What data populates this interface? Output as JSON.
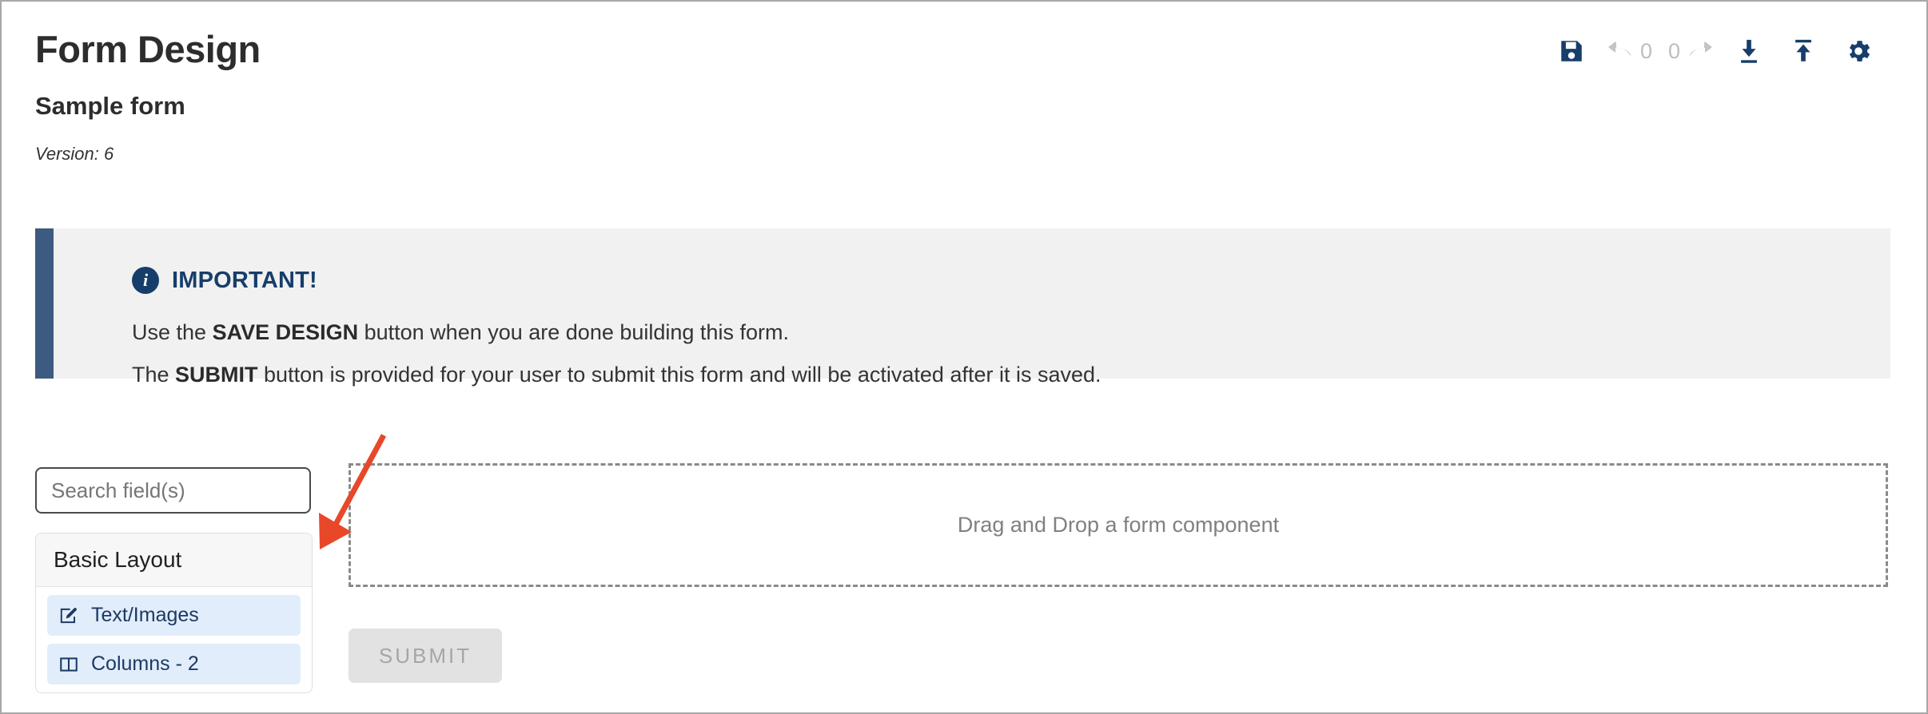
{
  "header": {
    "title": "Form Design",
    "form_name": "Sample form",
    "version": "Version: 6"
  },
  "toolbar": {
    "save_icon": "save-floppy-icon",
    "undo_icon": "undo-arrow-icon",
    "undo_count": "0",
    "redo_count": "0",
    "redo_icon": "redo-arrow-icon",
    "download_icon": "download-icon",
    "upload_icon": "upload-icon",
    "settings_icon": "gear-icon",
    "accent_color": "#173e6a",
    "disabled_color": "#bdbdbd"
  },
  "alert": {
    "icon": "info-circle-icon",
    "icon_letter": "i",
    "title": "IMPORTANT!",
    "line1_pre": "Use the ",
    "line1_strong": "SAVE DESIGN",
    "line1_post": " button when you are done building this form.",
    "line2_pre": "The ",
    "line2_strong": "SUBMIT",
    "line2_post": " button is provided for your user to submit this form and will be activated after it is saved.",
    "bar_color": "#3d5a80",
    "background_color": "#f1f1f1",
    "title_color": "#173e6a"
  },
  "sidebar": {
    "search": {
      "placeholder": "Search field(s)",
      "value": ""
    },
    "groups": [
      {
        "label": "Basic Layout",
        "items": [
          {
            "label": "Text/Images",
            "icon": "pencil-square-icon"
          },
          {
            "label": "Columns - 2",
            "icon": "columns-icon"
          }
        ]
      }
    ]
  },
  "canvas": {
    "dropzone_text": "Drag and Drop a form component",
    "submit_label": "SUBMIT"
  },
  "annotation": {
    "arrow_color": "#e8472a"
  }
}
